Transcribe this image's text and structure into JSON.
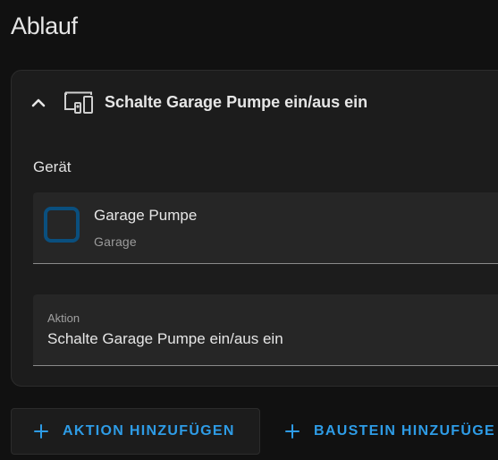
{
  "page": {
    "title": "Ablauf"
  },
  "action_card": {
    "title": "Schalte Garage Pumpe ein/aus ein",
    "collapse_icon": "chevron-up-icon",
    "type_icon": "device-icon",
    "device_section": {
      "label": "Gerät",
      "device_name": "Garage Pumpe",
      "device_area": "Garage",
      "avatar_color": "#0a4f7e"
    },
    "action_field": {
      "label": "Aktion",
      "value": "Schalte Garage Pumpe ein/aus ein"
    }
  },
  "buttons": {
    "add_action": "AKTION HINZUFÜGEN",
    "add_block": "BAUSTEIN HINZUFÜGE"
  },
  "colors": {
    "background": "#111111",
    "card": "#1c1c1c",
    "field": "#262626",
    "accent": "#2e9ce6"
  }
}
